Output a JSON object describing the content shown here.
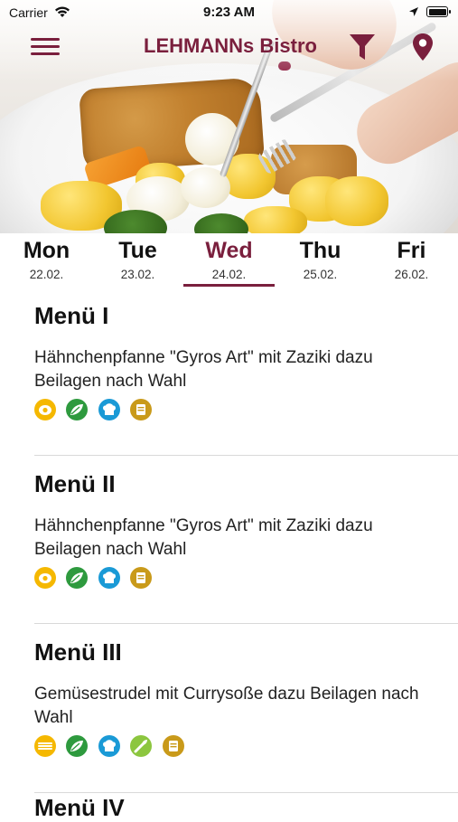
{
  "status_bar": {
    "carrier": "Carrier",
    "time": "9:23 AM"
  },
  "header": {
    "title": "LEHMANNs Bistro"
  },
  "days": [
    {
      "name": "Mon",
      "date": "22.02."
    },
    {
      "name": "Tue",
      "date": "23.02."
    },
    {
      "name": "Wed",
      "date": "24.02.",
      "selected": true
    },
    {
      "name": "Thu",
      "date": "25.02."
    },
    {
      "name": "Fri",
      "date": "26.02."
    }
  ],
  "menus": [
    {
      "title": "Menü I",
      "description": "Hähnchenpfanne \"Gyros Art\" mit Zaziki dazu Beilagen nach Wahl",
      "allergen_icons": [
        "egg-icon",
        "leaf-icon",
        "chef-hat-icon",
        "cup-icon"
      ]
    },
    {
      "title": "Menü II",
      "description": "Hähnchenpfanne \"Gyros Art\" mit Zaziki dazu Beilagen nach Wahl",
      "allergen_icons": [
        "egg-icon",
        "leaf-icon",
        "chef-hat-icon",
        "cup-icon"
      ]
    },
    {
      "title": "Menü III",
      "description": "Gemüsestrudel mit Currysoße dazu Beilagen nach Wahl",
      "allergen_icons": [
        "wheat-icon",
        "leaf-icon",
        "chef-hat-icon",
        "celery-icon",
        "cup-icon"
      ]
    },
    {
      "title": "Menü IV"
    }
  ],
  "colors": {
    "brand": "#7a1f3d",
    "egg": "#f5b800",
    "leaf": "#2e9a3e",
    "chef": "#1a9ad6",
    "cup": "#c99a1a",
    "celery": "#8cc63f"
  }
}
